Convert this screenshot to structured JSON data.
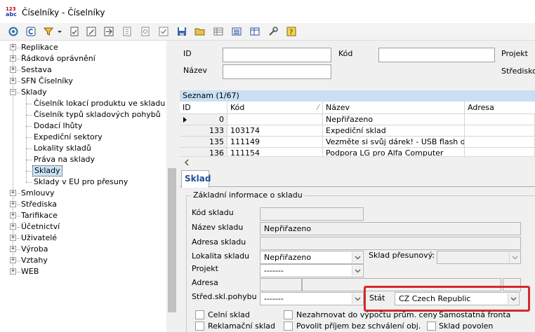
{
  "window": {
    "title": "Číselníky - Číselníky",
    "app_icon_top": "123",
    "app_icon_bottom": "abc"
  },
  "toolbar": {
    "icons": [
      "refresh-icon",
      "c-icon",
      "filter-icon",
      "dropdown-arrow-icon",
      "document-icon",
      "edit-icon",
      "insert-icon",
      "delete-icon",
      "copy-icon",
      "check-icon",
      "save-icon",
      "open-folder-icon",
      "grid-icon",
      "list-icon",
      "table-icon",
      "tools-icon",
      "help-icon"
    ]
  },
  "tree": {
    "items": [
      {
        "label": "Replikace",
        "level": 0,
        "expander": "+"
      },
      {
        "label": "Řádková oprávnění",
        "level": 0,
        "expander": "+"
      },
      {
        "label": "Sestava",
        "level": 0,
        "expander": "+"
      },
      {
        "label": "SFN Číselníky",
        "level": 0,
        "expander": "+"
      },
      {
        "label": "Sklady",
        "level": 0,
        "expander": "−"
      },
      {
        "label": "Číselník lokací produktu ve skladu",
        "level": 1
      },
      {
        "label": "Číselník typů skladových pohybů",
        "level": 1
      },
      {
        "label": "Dodací lhůty",
        "level": 1
      },
      {
        "label": "Expediční sektory",
        "level": 1
      },
      {
        "label": "Lokality skladů",
        "level": 1
      },
      {
        "label": "Práva na sklady",
        "level": 1
      },
      {
        "label": "Sklady",
        "level": 1,
        "selected": true
      },
      {
        "label": "Sklady v EU pro přesuny",
        "level": 1
      },
      {
        "label": "Smlouvy",
        "level": 0,
        "expander": "+"
      },
      {
        "label": "Střediska",
        "level": 0,
        "expander": "+"
      },
      {
        "label": "Tarifikace",
        "level": 0,
        "expander": "+"
      },
      {
        "label": "Účetnictví",
        "level": 0,
        "expander": "+"
      },
      {
        "label": "Uživatelé",
        "level": 0,
        "expander": "+"
      },
      {
        "label": "Výroba",
        "level": 0,
        "expander": "+"
      },
      {
        "label": "Vztahy",
        "level": 0,
        "expander": "+"
      },
      {
        "label": "WEB",
        "level": 0,
        "expander": "+"
      }
    ]
  },
  "filter": {
    "id_label": "ID",
    "kod_label": "Kód",
    "projekt_label": "Projekt",
    "nazev_label": "Název",
    "stredisko_label": "Středisko"
  },
  "list": {
    "title": "Seznam (1/67)",
    "columns": [
      "ID",
      "Kód",
      "Název",
      "Adresa"
    ],
    "rows": [
      {
        "current": true,
        "id": "0",
        "kod": "",
        "nazev": "Nepřiřazeno",
        "adresa": ""
      },
      {
        "current": false,
        "id": "133",
        "kod": "103174",
        "nazev": "Expediční sklad",
        "adresa": ""
      },
      {
        "current": false,
        "id": "135",
        "kod": "111149",
        "nazev": "Vezměte si svůj dárek! -  USB flash dis",
        "adresa": ""
      },
      {
        "current": false,
        "id": "136",
        "kod": "111154",
        "nazev": "Podpora LG pro Alfa Computer",
        "adresa": ""
      }
    ]
  },
  "detail": {
    "tab": "Sklad",
    "group_title": "Základní informace o skladu",
    "kod_skladu_label": "Kód skladu",
    "kod_skladu_value": "",
    "nazev_skladu_label": "Název skladu",
    "nazev_skladu_value": "Nepřiřazeno",
    "adresa_skladu_label": "Adresa skladu",
    "adresa_skladu_value": "",
    "lokalita_label": "Lokalita skladu",
    "lokalita_value": "Nepřiřazeno",
    "sklad_presunovy_label": "Sklad přesunový:",
    "sklad_presunovy_value": "",
    "projekt_label": "Projekt",
    "projekt_value": "-------",
    "adresa_label": "Adresa",
    "stred_label": "Střed.skl.pohybu",
    "stred_value": "-------",
    "stat_label": "Stát",
    "stat_value": "CZ  Czech Republic",
    "checkboxes": {
      "celni": "Celní sklad",
      "nezahrnovat": "Nezahrnovat do výpočtu prům. ceny",
      "samostatna": "Samostatná fronta",
      "reklamacni": "Reklamační sklad",
      "povolit": "Povolit příjem bez schválení obj.",
      "sklad_povolen": "Sklad povolen"
    }
  },
  "colors": {
    "highlight": "#d52a2a",
    "list_title_bg": "#c9dff3",
    "tab_text": "#1f4e99",
    "selection": "#cce4f7"
  }
}
